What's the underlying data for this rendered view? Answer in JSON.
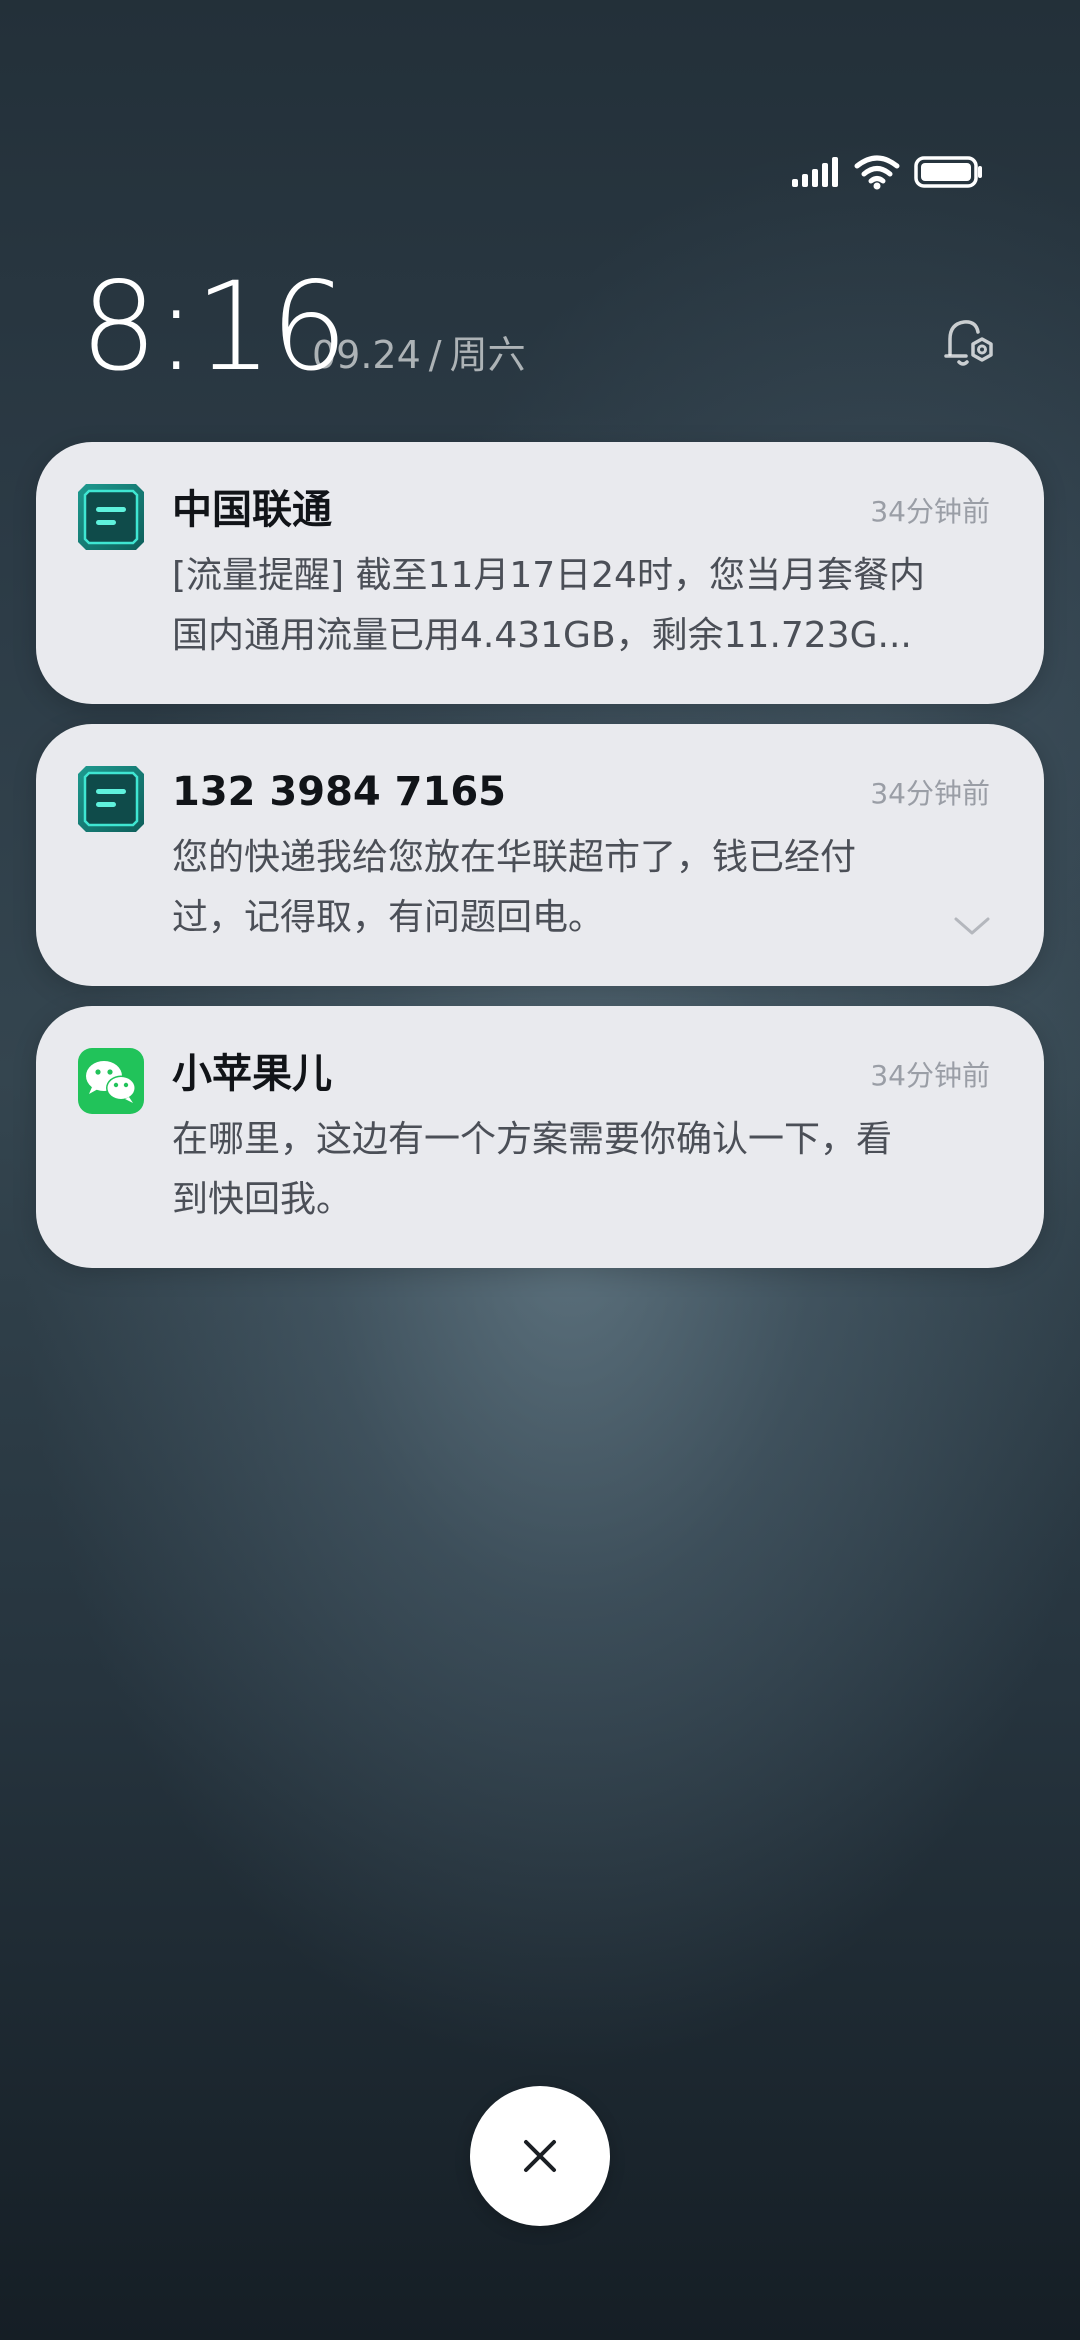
{
  "lockscreen": {
    "time": "8:16",
    "date": "09.24",
    "weekday": "周六",
    "date_separator": "/"
  },
  "status_bar": {
    "icons": [
      "signal-icon",
      "wifi-icon",
      "battery-icon"
    ],
    "battery_level": 1.0
  },
  "notifications": [
    {
      "app_icon": "unicom-message-icon",
      "title": "中国联通",
      "time_ago": "34分钟前",
      "body_lines": [
        "[流量提醒] 截至11月17日24时，您当月套餐内",
        "国内通用流量已用4.431GB，剩余11.723G..."
      ],
      "expandable": false
    },
    {
      "app_icon": "sms-message-icon",
      "title": "132 3984 7165",
      "time_ago": "34分钟前",
      "body_lines": [
        "您的快递我给您放在华联超市了，钱已经付",
        "过，记得取，有问题回电。"
      ],
      "expandable": true
    },
    {
      "app_icon": "wechat-icon",
      "title": "小苹果儿",
      "time_ago": "34分钟前",
      "body_lines": [
        "在哪里，这边有一个方案需要你确认一下，看",
        "到快回我。"
      ],
      "expandable": false
    }
  ],
  "colors": {
    "card_bg": "#e9eaee",
    "title": "#111418",
    "body": "#4b4f57",
    "meta": "#9a9ea6",
    "message_icon_teal": "#1d8f86",
    "wechat_green": "#21c35a"
  }
}
